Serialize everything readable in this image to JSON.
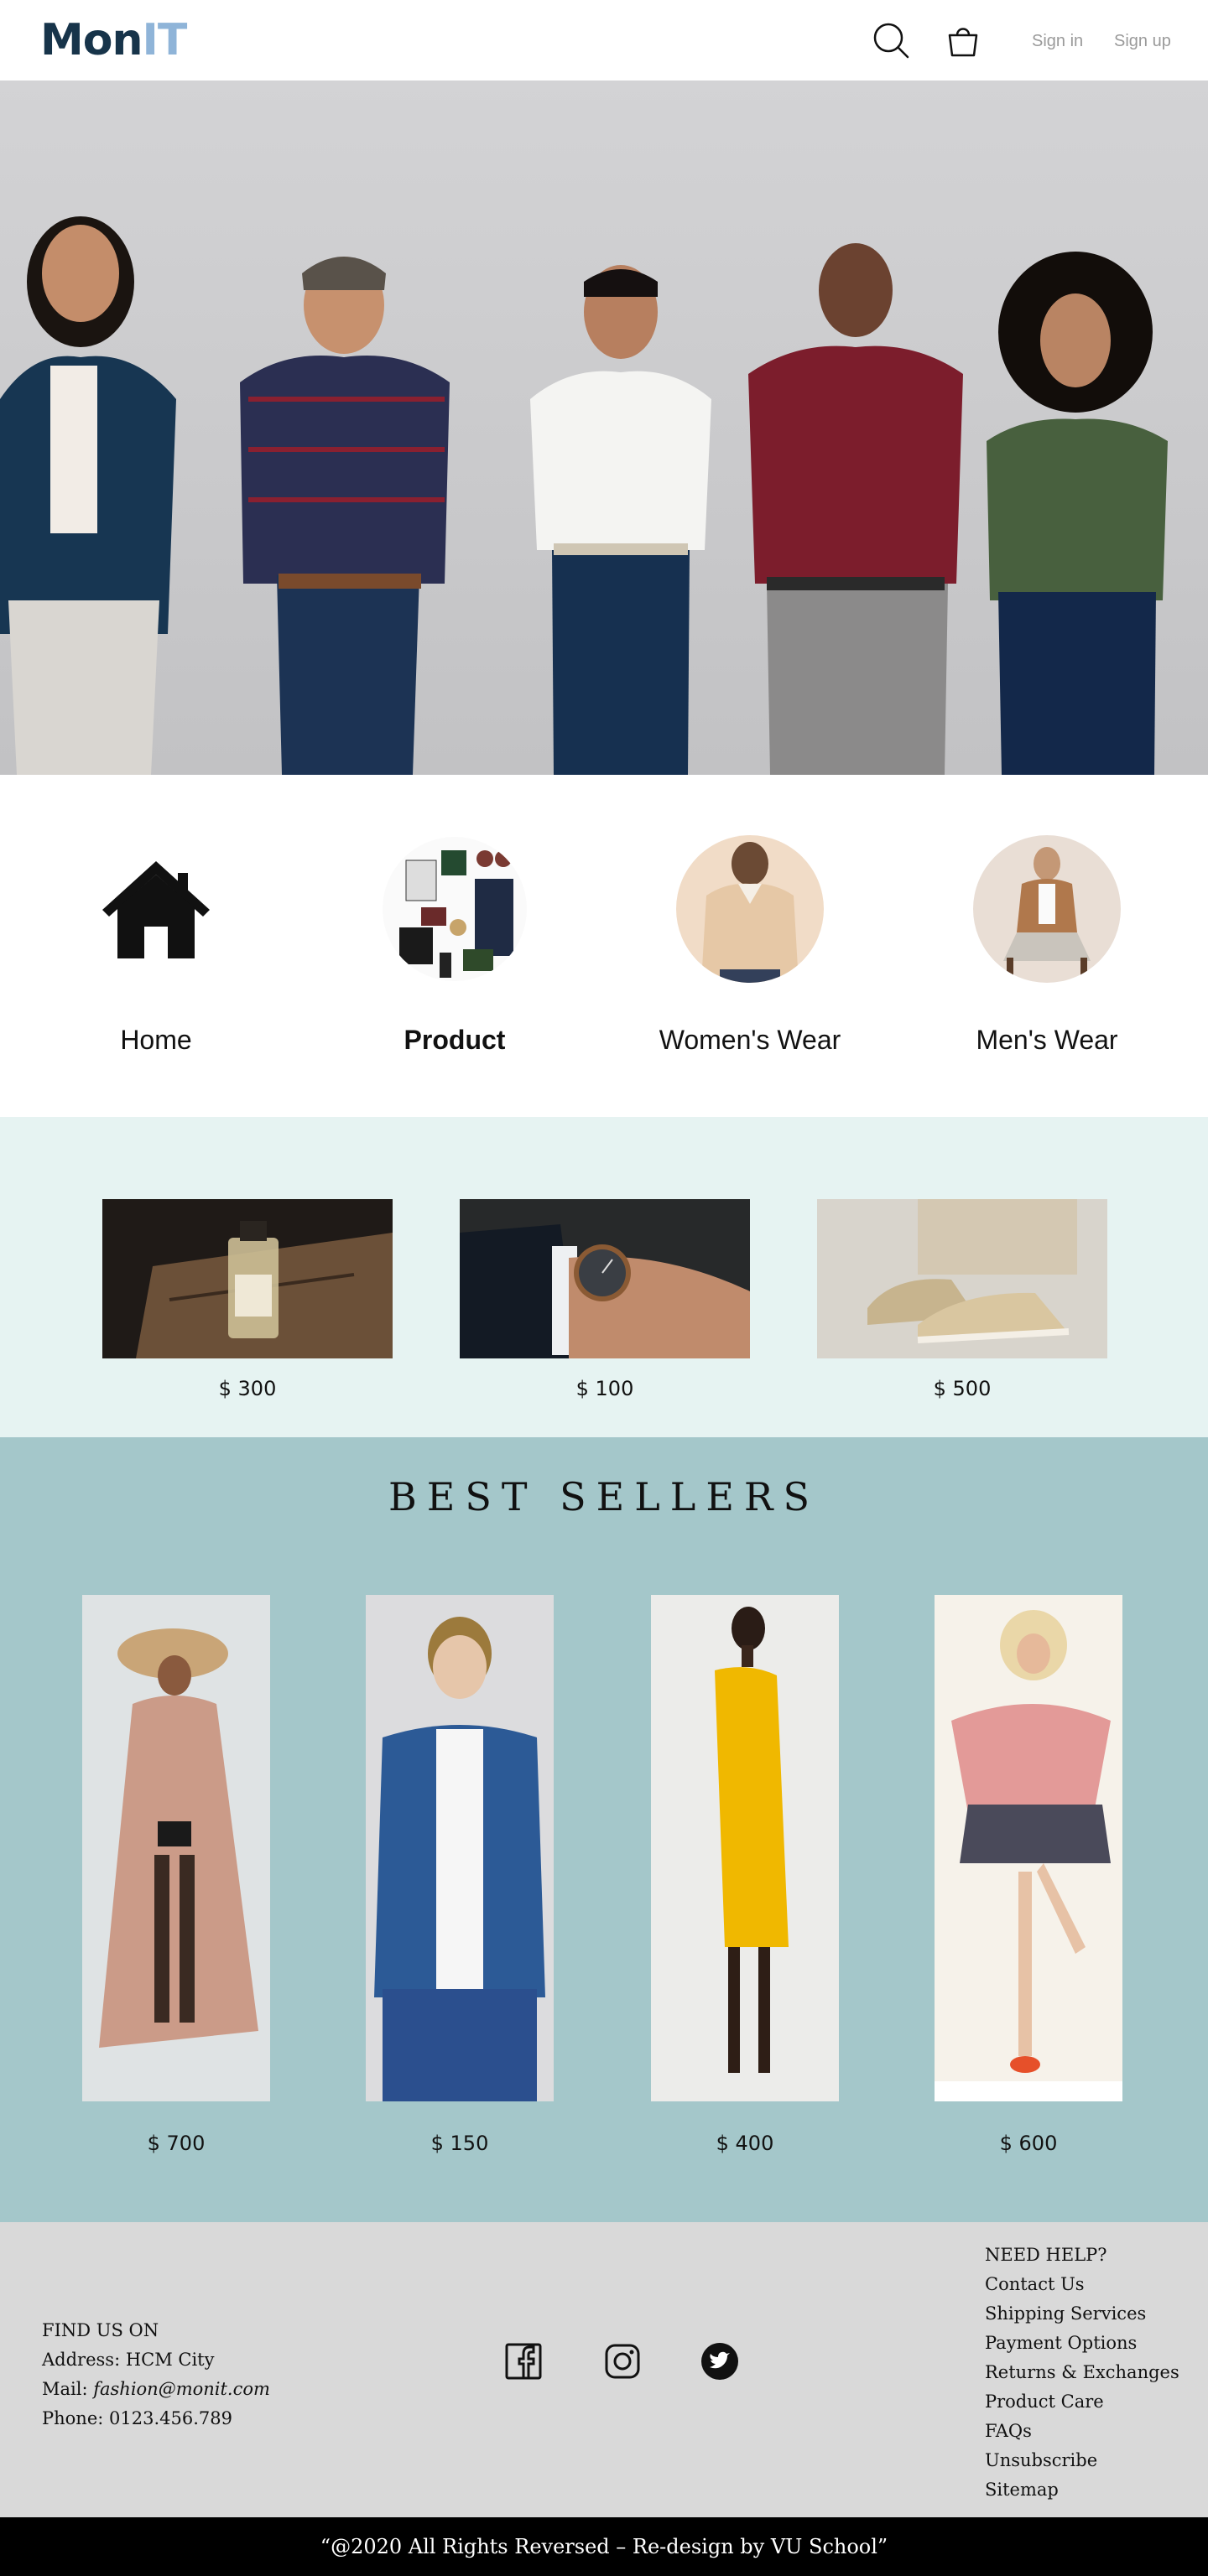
{
  "header": {
    "logo_left": "Mon",
    "logo_right": "IT",
    "sign_in": "Sign in",
    "sign_up": "Sign up"
  },
  "categories": [
    {
      "label": "Home",
      "icon": "house-icon"
    },
    {
      "label": "Product",
      "icon": "product-collage"
    },
    {
      "label": "Women's Wear",
      "icon": "women-thumbnail"
    },
    {
      "label": "Men's Wear",
      "icon": "men-thumbnail"
    }
  ],
  "featured": [
    {
      "price": "$ 300",
      "image": "perfume-bottle"
    },
    {
      "price": "$ 100",
      "image": "wrist-watch"
    },
    {
      "price": "$ 500",
      "image": "sneakers"
    }
  ],
  "best_sellers": {
    "title": "BEST SELLERS",
    "items": [
      {
        "price": "$ 700",
        "image": "woman-in-sheer-dress"
      },
      {
        "price": "$ 150",
        "image": "man-in-denim-jacket"
      },
      {
        "price": "$ 400",
        "image": "woman-in-yellow-dress"
      },
      {
        "price": "$ 600",
        "image": "woman-in-sport-outfit"
      }
    ]
  },
  "footer": {
    "find_us": "FIND US ON",
    "address": "Address: HCM City",
    "mail_label": "Mail: ",
    "mail": "fashion@monit.com",
    "phone": "Phone: 0123.456.789",
    "help_title": "NEED HELP?",
    "help_links": [
      "Contact Us",
      "Shipping Services",
      "Payment Options",
      "Returns & Exchanges",
      "Product Care",
      "FAQs",
      "Unsubscribe",
      "Sitemap"
    ],
    "copyright": "“@2020 All Rights Reversed – Re-design by VU School”"
  },
  "colors": {
    "logo_dark": "#17344a",
    "logo_light": "#8fb4d8",
    "featured_bg": "#e6f3f2",
    "best_bg": "#a4c7ca",
    "footer_bg": "#d9d9d9"
  }
}
